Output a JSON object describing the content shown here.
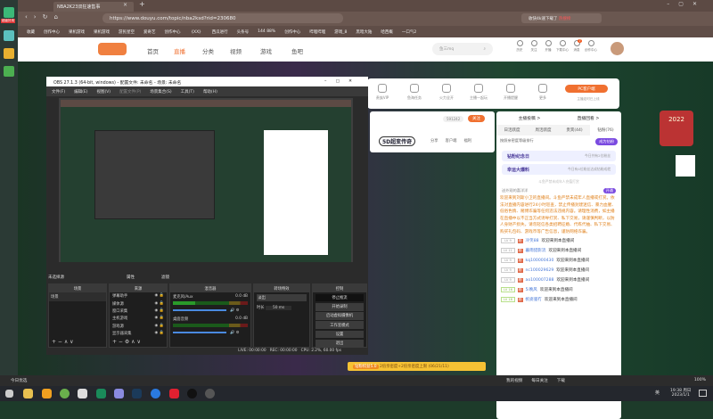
{
  "desktop": {
    "badge": "超级好用"
  },
  "browser": {
    "tab_title": "NBA2K23双狂速售事",
    "url": "https://www.douyu.com/topic/nba2ksd?rid=230680",
    "search_placeholder": "收快4k速下载了",
    "search_tag": "热搜榜",
    "bookmarks": [
      "收藏",
      "创作中心",
      "果机游戏",
      "果机游戏",
      "游民星空",
      "爱奇艺",
      "创作中心",
      "《XX》",
      "西瓜进行",
      "头条号",
      "144 88%",
      "创作中心",
      "哔哩哔哩",
      "游戏_8",
      "黑暗大陆",
      "哈西概",
      "一口气2"
    ]
  },
  "douyu": {
    "nav": [
      "首页",
      "直播",
      "分类",
      "视频",
      "游戏",
      "鱼吧"
    ],
    "search_placeholder": "鱼三mq",
    "user_icons": [
      "历史",
      "关注",
      "开播",
      "下载中心",
      "消息",
      "创作中心"
    ],
    "msg_badge": "7",
    "toolbar": [
      "贵族VIP",
      "鱼海任务",
      "火力全开",
      "主播一起玩",
      "开播提醒",
      "更多"
    ],
    "pc_client": "PC客户端",
    "pc_sub": "主播定时已上线",
    "room": {
      "count": "591242",
      "follow": "关注",
      "logo_text": "5D超变传奇",
      "share": "分享",
      "client": "客户端",
      "welfare": "福利"
    },
    "chat": {
      "top_links": [
        "主播投稿 >",
        "直播回看 >"
      ],
      "tabs": [
        "日活跃度",
        "周活跃度",
        "贵宾(44)",
        "钻粉(76)"
      ],
      "rank_label": "按照亲密度等级排行",
      "join_btn": "成为钻粉",
      "card1": {
        "title": "钻粉纪念日",
        "sub": "今日共有2位粉丝"
      },
      "card2": {
        "title": "幸运大爆料",
        "sub": "今日有4位粉丝达成钻粉成就"
      },
      "hint": "斗鱼严禁未成年人充值打赏",
      "open_btn": "开通",
      "protect": "送外观的喜洋洋",
      "notice": "欢迎来到刘斯小卫的直播间。斗鱼严禁未成年人直播或打赏。依法对直播内容进行24小时巡查，禁止传播封建迷信、暴力血腥、低俗色情、赌博诈骗等任何违法违规内容。请理性消费，如主播在直播中以不正当方式诱导打赏、私下交易，请谨慎判断，以防人身财产损失。请勿轻信各类招聘征婚、代练代抽、私下交易、购买礼包码、游戏币等广告信息，谨防网络诈骗。",
      "messages": [
        {
          "lv": "LV 9",
          "name": "冷笑88",
          "text": "欢迎来到本直播间"
        },
        {
          "lv": "LV 11",
          "name": "暮雨猎影流",
          "text": "欢迎来到本直播间"
        },
        {
          "lv": "LV 9",
          "name": "kq100000430",
          "text": "欢迎来到本直播间"
        },
        {
          "lv": "LV 9",
          "name": "nc100029629",
          "text": "欢迎来到本直播间"
        },
        {
          "lv": "LV 9",
          "name": "ao100007288",
          "text": "欢迎来到本直播间"
        },
        {
          "lv": "LV 16",
          "name": "5i晚风",
          "text": "欢迎来到本直播间"
        },
        {
          "lv": "LV 18",
          "name": "帆姿骚冇",
          "text": "欢迎来到本直播间"
        }
      ],
      "fan_badge": "粉"
    },
    "gift": {
      "tag": "钻粉权益5.0",
      "text": "2倍亲密度+2倍亲密度上限 (06/21/11)"
    },
    "deco_year": "2022"
  },
  "obs": {
    "title": "OBS 27.1.3 (64-bit, windows) - 配置文件: 未命名 - 场景: 未命名",
    "menu": [
      "文件(F)",
      "编辑(E)",
      "视图(V)",
      "配置文件(P)",
      "场景集合(S)",
      "工具(T)",
      "帮助(H)"
    ],
    "no_source": "未选择源",
    "props": "属性",
    "filters": "滤镜",
    "panels": {
      "scenes": "场景",
      "sources": "来源",
      "mixer": "混音器",
      "transitions": "转场特效",
      "controls": "控制"
    },
    "scene_items": [
      "场景"
    ],
    "source_items": [
      "弹幕助手",
      "媒体源",
      "窗口采集",
      "主机游戏",
      "游戏源",
      "显示器采集"
    ],
    "mixer": [
      {
        "name": "麦克风/Aux",
        "db": "0.0 dB"
      },
      {
        "name": "桌面音频",
        "db": "0.0 dB"
      }
    ],
    "transition": {
      "type": "淡出",
      "duration_label": "时长",
      "duration": "50 ms"
    },
    "controls": [
      "停止推流",
      "开始录制",
      "启动虚拟摄像机",
      "工作室模式",
      "设置",
      "退出"
    ],
    "status": {
      "live": "LIVE: 00:00:00",
      "rec": "REC: 00:00:00",
      "cpu": "CPU: 2.2%, 60.00 fps"
    }
  },
  "statusbar": {
    "left": "今日优选",
    "items": [
      "我的视频",
      "每日关注",
      "下载"
    ],
    "zoom": "100%"
  },
  "taskbar": {
    "time": "19:38 周日",
    "date": "2023/1/1",
    "ime": "英"
  }
}
